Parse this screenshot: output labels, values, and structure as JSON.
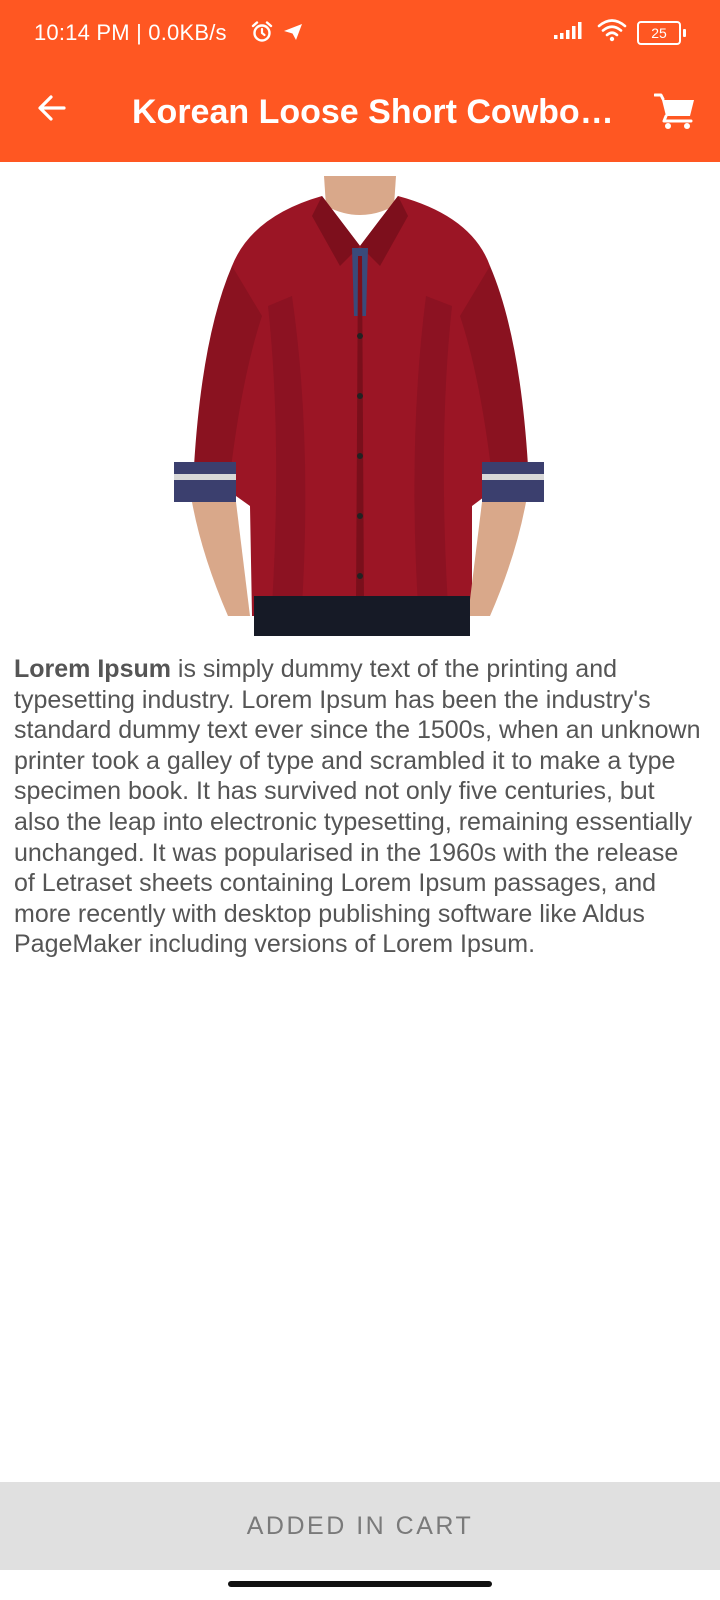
{
  "status_bar": {
    "time": "10:14 PM | 0.0KB/s",
    "battery": "25",
    "icons": [
      "alarm-icon",
      "telegram-icon",
      "signal-icon",
      "wifi-icon",
      "battery-icon"
    ]
  },
  "app_bar": {
    "title": "Korean Loose Short Cowboy Jacket",
    "back_icon": "arrow-left-icon",
    "cart_icon": "shopping-cart-icon",
    "background": "#FF5722"
  },
  "product": {
    "image": "red-shirt-product-photo",
    "description_bold": "Lorem Ipsum",
    "description_rest": " is simply dummy text of the printing and typesetting industry. Lorem Ipsum has been the industry's standard dummy text ever since the 1500s, when an unknown printer took a galley of type and scrambled it to make a type specimen book. It has survived not only five centuries, but also the leap into electronic typesetting, remaining essentially unchanged. It was popularised in the 1960s with the release of Letraset sheets containing Lorem Ipsum passages, and more recently with desktop publishing software like Aldus PageMaker including versions of Lorem Ipsum."
  },
  "footer": {
    "cart_button_label": "ADDED IN CART"
  }
}
